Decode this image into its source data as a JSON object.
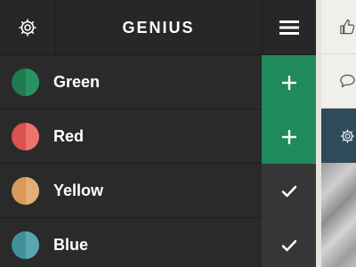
{
  "header": {
    "title": "GENIUS",
    "settings_icon": "gear-icon",
    "menu_icon": "hamburger-icon"
  },
  "colors": {
    "background": "#262626",
    "accent_green": "#1f8a5b",
    "done_gray": "#363636",
    "side_active": "#2f4a59"
  },
  "rows": [
    {
      "label": "Green",
      "swatch": "#1f7a4f",
      "swatch_shade": "#2a9562",
      "action_icon": "plus-icon",
      "action_state": "add"
    },
    {
      "label": "Red",
      "swatch": "#d9534f",
      "swatch_shade": "#ee7770",
      "action_icon": "plus-icon",
      "action_state": "add"
    },
    {
      "label": "Yellow",
      "swatch": "#d59a5c",
      "swatch_shade": "#e6b07a",
      "action_icon": "check-icon",
      "action_state": "done"
    },
    {
      "label": "Blue",
      "swatch": "#3f8f9c",
      "swatch_shade": "#5aa8b5",
      "action_icon": "check-icon",
      "action_state": "done"
    }
  ],
  "side_panel": {
    "icons": [
      "thumbs-up-icon",
      "speech-bubble-icon",
      "gear-icon"
    ]
  }
}
